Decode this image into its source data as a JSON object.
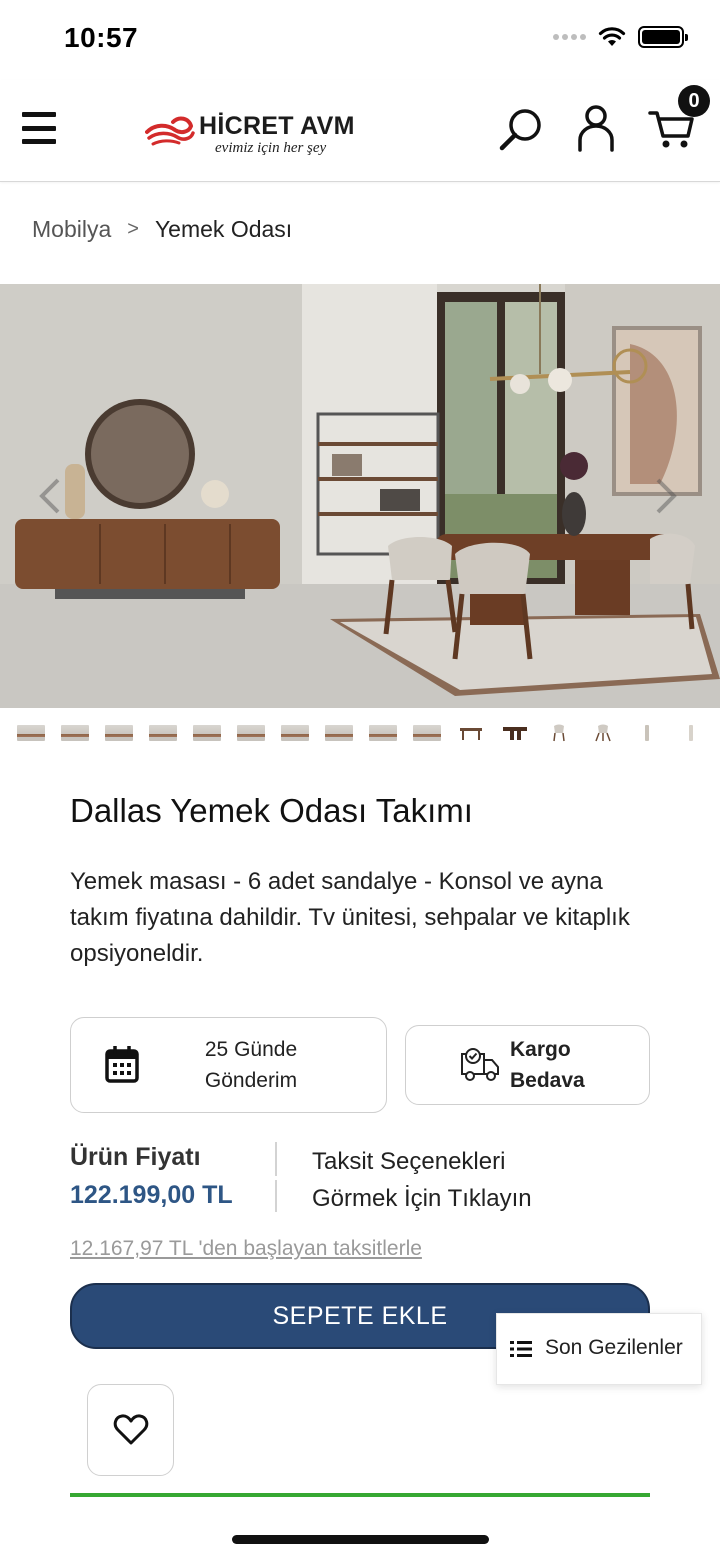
{
  "status_bar": {
    "time": "10:57"
  },
  "header": {
    "menu_icon": "hamburger-menu-icon",
    "logo_title": "HİCRET AVM",
    "logo_tagline": "evimiz için her şey",
    "search_icon": "search-icon",
    "user_icon": "user-icon",
    "cart_icon": "cart-icon",
    "cart_count": "0"
  },
  "breadcrumb": {
    "parent": "Mobilya",
    "separator": ">",
    "current": "Yemek Odası"
  },
  "gallery": {
    "thumbnail_count": 16,
    "prev_icon": "chevron-left-icon",
    "next_icon": "chevron-right-icon"
  },
  "product": {
    "title": "Dallas Yemek Odası Takımı",
    "description": "Yemek masası - 6 adet sandalye - Konsol ve ayna takım fiyatına dahildir. Tv ünitesi, sehpalar ve kitaplık opsiyoneldir.",
    "features": [
      {
        "icon": "calendar-icon",
        "line1": "25 Günde",
        "line2": "Gönderim"
      },
      {
        "icon": "delivery-truck-icon",
        "line1": "Kargo",
        "line2": "Bedava"
      }
    ],
    "price_label": "Ürün Fiyatı",
    "price_value": "122.199,00 TL",
    "installment_line1": "Taksit Seçenekleri",
    "installment_line2": "Görmek İçin Tıklayın",
    "installment_note": "12.167,97 TL 'den başlayan taksitlerle",
    "add_to_cart": "SEPETE EKLE",
    "favorite_icon": "heart-icon"
  },
  "recent_panel": {
    "icon": "list-icon",
    "label": "Son Gezilenler"
  },
  "colors": {
    "primary": "#2a4a77",
    "price": "#2e5685",
    "accent_green": "#36a832"
  }
}
